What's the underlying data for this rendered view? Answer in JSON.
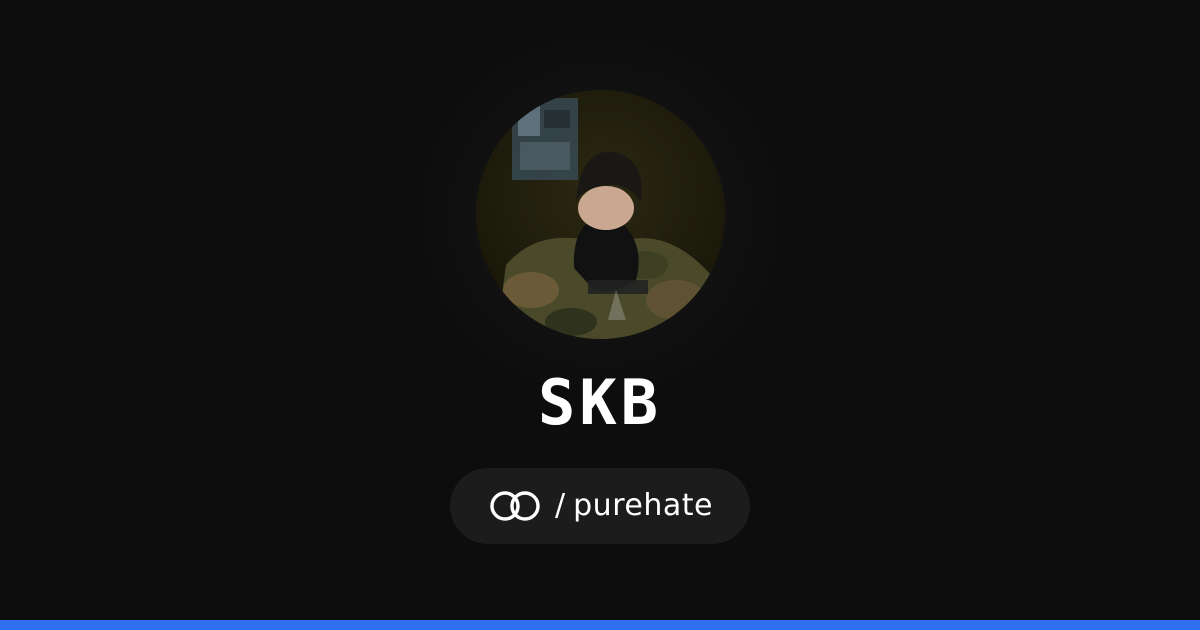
{
  "profile": {
    "name": "SKB",
    "separator": "/",
    "handle": "purehate",
    "avatar": {
      "description_icon": "profile-photo",
      "tone": "#2a2712"
    }
  },
  "icons": {
    "link": "linked-rings-icon"
  },
  "colors": {
    "background": "#0d0d0d",
    "pill": "#1c1c1c",
    "text": "#ffffff",
    "accent_bar": "#2f6ff0"
  }
}
